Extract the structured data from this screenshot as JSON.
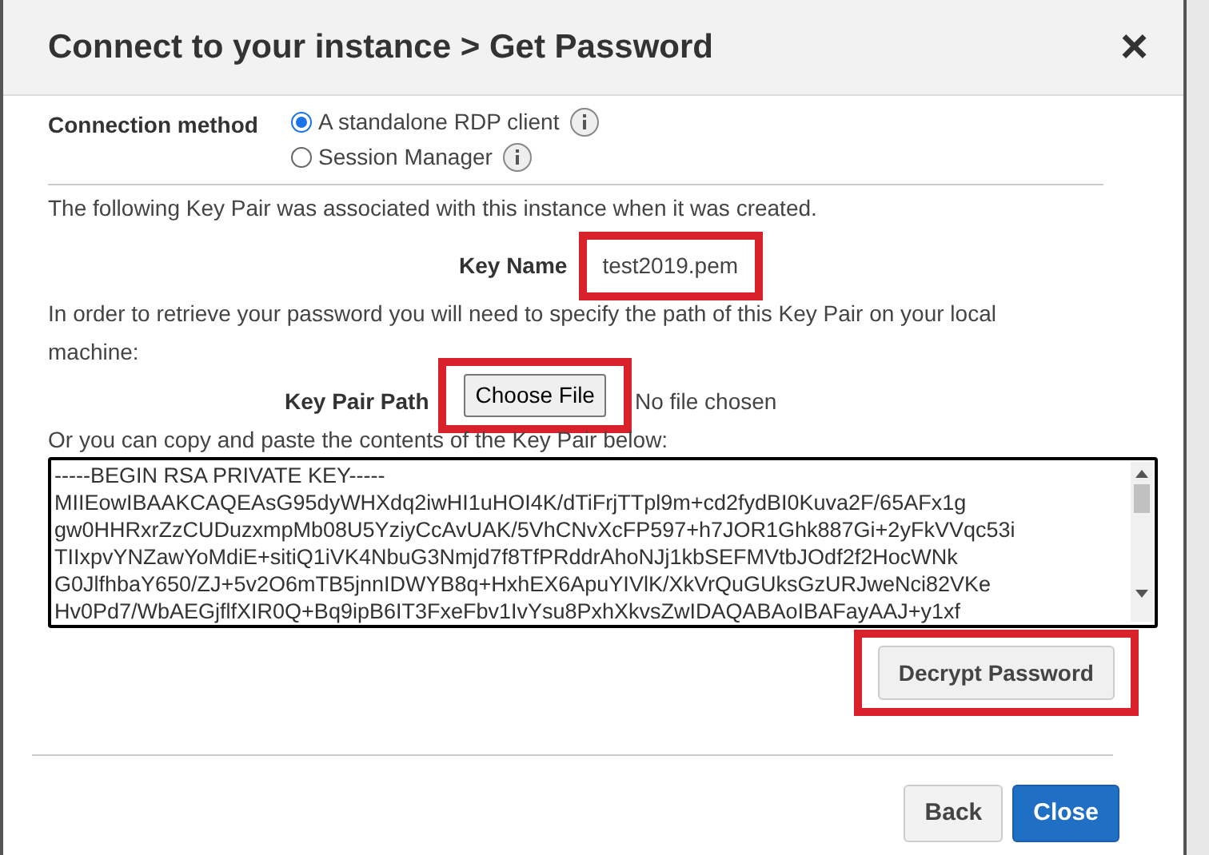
{
  "dialog": {
    "title": "Connect to your instance > Get Password",
    "close": "×"
  },
  "connection_method": {
    "label": "Connection method",
    "options": [
      {
        "label": "A standalone RDP client",
        "selected": true
      },
      {
        "label": "Session Manager",
        "selected": false
      }
    ]
  },
  "intro": "The following Key Pair was associated with this instance when it was created.",
  "key_name": {
    "label": "Key Name",
    "value": "test2019.pem",
    "highlighted": true
  },
  "retrieve_text": "In order to retrieve your password you will need to specify the path of this Key Pair on your local machine:",
  "key_pair_path": {
    "label": "Key Pair Path",
    "button": "Choose File",
    "status": "No file chosen",
    "highlighted": true
  },
  "paste_text": "Or you can copy and paste the contents of the Key Pair below:",
  "key_contents": [
    "-----BEGIN RSA PRIVATE KEY-----",
    "MIIEowIBAAKCAQEAsG95dyWHXdq2iwHI1uHOI4K/dTiFrjTTpl9m+cd2fydBI0Kuva2F/65AFx1g",
    "gw0HHRxrZzCUDuzxmpMb08U5YziyCcAvUAK/5VhCNvXcFP597+h7JOR1Ghk887Gi+2yFkVVqc53i",
    "TIIxpvYNZawYoMdiE+sitiQ1iVK4NbuG3Nmjd7f8TfPRddrAhoNJj1kbSEFMVtbJOdf2f2HocWNk",
    "G0JlfhbaY650/ZJ+5v2O6mTB5jnnIDWYB8q+HxhEX6ApuYIVlK/XkVrQuGUksGzURJweNci82VKe",
    "Hv0Pd7/WbAEGjflfXIR0Q+Bq9ipB6IT3FxeFbv1IvYsu8PxhXkvsZwIDAQABAoIBAFayAAJ+y1xf"
  ],
  "decrypt": {
    "label": "Decrypt Password",
    "highlighted": true
  },
  "buttons": [
    {
      "label": "Back",
      "kind": "secondary"
    },
    {
      "label": "Close",
      "kind": "primary"
    }
  ]
}
